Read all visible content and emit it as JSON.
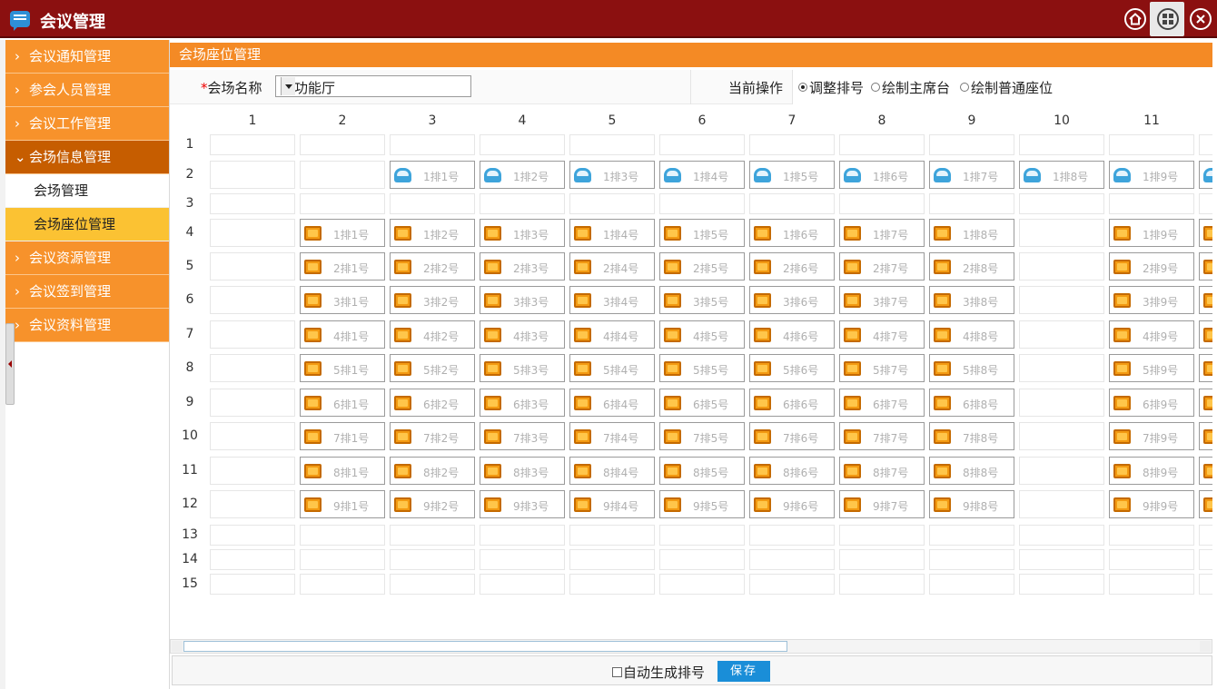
{
  "app": {
    "title": "会议管理"
  },
  "sidebar": {
    "items": [
      {
        "label": "会议通知管理",
        "expanded": false
      },
      {
        "label": "参会人员管理",
        "expanded": false
      },
      {
        "label": "会议工作管理",
        "expanded": false
      },
      {
        "label": "会场信息管理",
        "expanded": true,
        "children": [
          {
            "label": "会场管理",
            "selected": false
          },
          {
            "label": "会场座位管理",
            "selected": true
          }
        ]
      },
      {
        "label": "会议资源管理",
        "expanded": false
      },
      {
        "label": "会议签到管理",
        "expanded": false
      },
      {
        "label": "会议资料管理",
        "expanded": false
      }
    ]
  },
  "panel": {
    "title": "会场座位管理"
  },
  "form": {
    "required_mark": "*",
    "venue_label": "会场名称",
    "venue_value": "多功能厅",
    "operation_label": "当前操作",
    "operations": [
      {
        "label": "调整排号",
        "checked": true
      },
      {
        "label": "绘制主席台",
        "checked": false
      },
      {
        "label": "绘制普通座位",
        "checked": false
      }
    ]
  },
  "grid": {
    "columns": [
      "1",
      "2",
      "3",
      "4",
      "5",
      "6",
      "7",
      "8",
      "9",
      "10",
      "11"
    ],
    "rows": [
      "1",
      "2",
      "3",
      "4",
      "5",
      "6",
      "7",
      "8",
      "9",
      "10",
      "11",
      "12",
      "13",
      "14",
      "15"
    ],
    "podium_seats": [
      "1排1号",
      "1排2号",
      "1排3号",
      "1排4号",
      "1排5号",
      "1排6号",
      "1排7号",
      "1排8号",
      "1排9号"
    ],
    "seat_rows": [
      [
        "1排1号",
        "1排2号",
        "1排3号",
        "1排4号",
        "1排5号",
        "1排6号",
        "1排7号",
        "1排8号",
        "1排9号"
      ],
      [
        "2排1号",
        "2排2号",
        "2排3号",
        "2排4号",
        "2排5号",
        "2排6号",
        "2排7号",
        "2排8号",
        "2排9号"
      ],
      [
        "3排1号",
        "3排2号",
        "3排3号",
        "3排4号",
        "3排5号",
        "3排6号",
        "3排7号",
        "3排8号",
        "3排9号"
      ],
      [
        "4排1号",
        "4排2号",
        "4排3号",
        "4排4号",
        "4排5号",
        "4排6号",
        "4排7号",
        "4排8号",
        "4排9号"
      ],
      [
        "5排1号",
        "5排2号",
        "5排3号",
        "5排4号",
        "5排5号",
        "5排6号",
        "5排7号",
        "5排8号",
        "5排9号"
      ],
      [
        "6排1号",
        "6排2号",
        "6排3号",
        "6排4号",
        "6排5号",
        "6排6号",
        "6排7号",
        "6排8号",
        "6排9号"
      ],
      [
        "7排1号",
        "7排2号",
        "7排3号",
        "7排4号",
        "7排5号",
        "7排6号",
        "7排7号",
        "7排8号",
        "7排9号"
      ],
      [
        "8排1号",
        "8排2号",
        "8排3号",
        "8排4号",
        "8排5号",
        "8排6号",
        "8排7号",
        "8排8号",
        "8排9号"
      ],
      [
        "9排1号",
        "9排2号",
        "9排3号",
        "9排4号",
        "9排5号",
        "9排6号",
        "9排7号",
        "9排8号",
        "9排9号"
      ]
    ]
  },
  "footer": {
    "auto_number_label": "自动生成排号",
    "auto_number_checked": false,
    "save_label": "保存"
  },
  "colors": {
    "titlebar": "#8b1010",
    "sidebar_item": "#f7922b",
    "sidebar_active": "#c65d00",
    "sidebar_selected": "#fbc233",
    "panel_header": "#f48a25",
    "save_button": "#1a8ed8"
  },
  "icons": {
    "app": "chat-bubble-icon",
    "home": "home-icon",
    "apps": "grid-icon",
    "close": "close-icon",
    "podium_seat": "podium-seat-icon",
    "normal_seat": "seat-icon"
  }
}
